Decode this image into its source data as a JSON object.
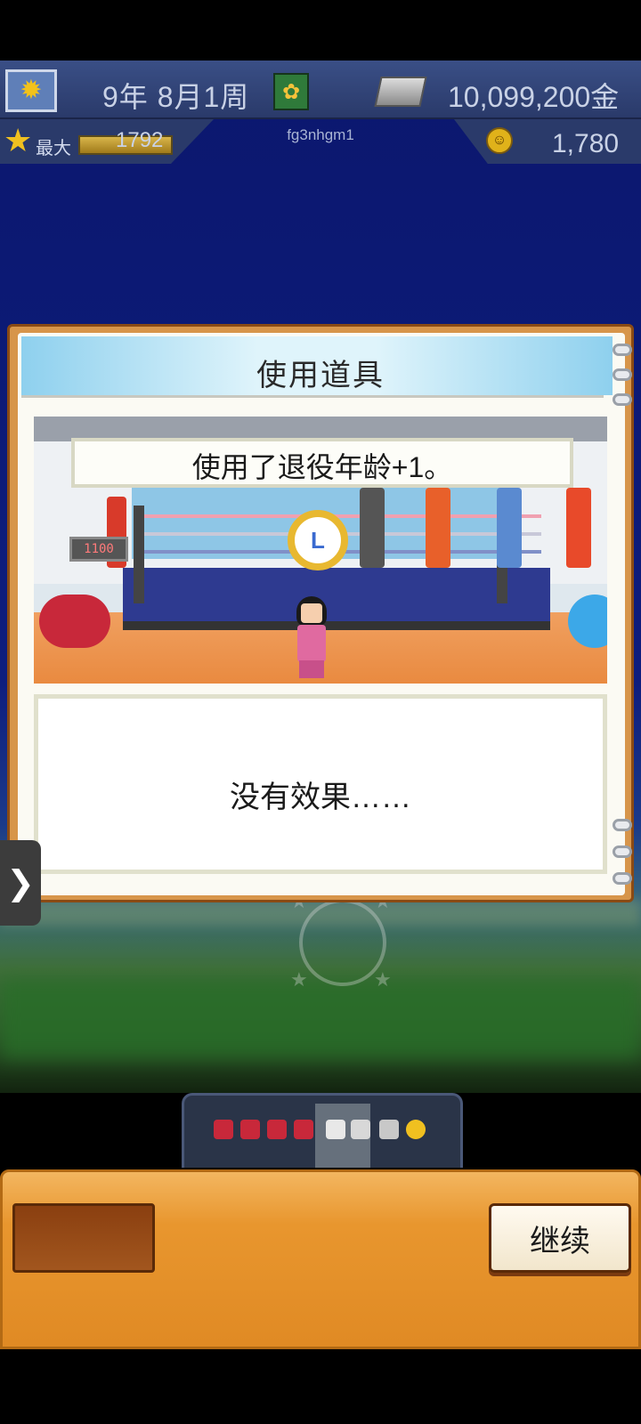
{
  "status": {
    "date": "9年 8月1周",
    "money": "10,099,200金",
    "max_label": "最大",
    "max_value": "1792",
    "player_id": "fg3nhgm1",
    "points": "1,780"
  },
  "dialog": {
    "title": "使用道具",
    "message": "使用了退役年龄+1。",
    "result": "没有效果……",
    "scale_readout": "1100"
  },
  "actions": {
    "continue_label": "继续"
  },
  "icons": {
    "settings": "settings-icon",
    "calendar": "calendar-icon",
    "money": "money-icon",
    "star": "star-icon",
    "smile": "smile-icon",
    "clock": "clock-icon",
    "expand": "chevron-right-icon"
  },
  "colors": {
    "background": "#0e1d7e",
    "status_bar": "#2a3a6a",
    "dialog_frame": "#d7954a",
    "header_gradient": "#8ed0ee",
    "panel": "#e8962e"
  }
}
